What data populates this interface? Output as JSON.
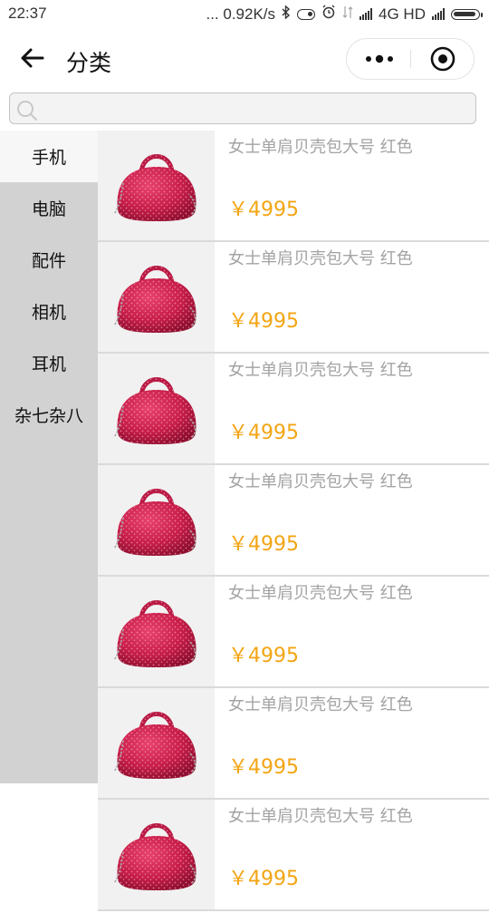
{
  "status": {
    "time": "22:37",
    "net_speed": "0.92K/s",
    "network": "4G HD",
    "battery_level": 0.9
  },
  "header": {
    "title": "分类",
    "back_icon": "arrow-left-icon",
    "more_icon": "more-dots-icon",
    "close_icon": "target-icon"
  },
  "search": {
    "placeholder": "",
    "value": ""
  },
  "categories": [
    {
      "label": "手机",
      "active": true
    },
    {
      "label": "电脑",
      "active": false
    },
    {
      "label": "配件",
      "active": false
    },
    {
      "label": "相机",
      "active": false
    },
    {
      "label": "耳机",
      "active": false
    },
    {
      "label": "杂七杂八",
      "active": false
    }
  ],
  "products": [
    {
      "name": "女士单肩贝壳包大号 红色",
      "price": "￥4995"
    },
    {
      "name": "女士单肩贝壳包大号 红色",
      "price": "￥4995"
    },
    {
      "name": "女士单肩贝壳包大号 红色",
      "price": "￥4995"
    },
    {
      "name": "女士单肩贝壳包大号 红色",
      "price": "￥4995"
    },
    {
      "name": "女士单肩贝壳包大号 红色",
      "price": "￥4995"
    },
    {
      "name": "女士单肩贝壳包大号 红色",
      "price": "￥4995"
    },
    {
      "name": "女士单肩贝壳包大号 红色",
      "price": "￥4995"
    }
  ],
  "colors": {
    "price": "#f3a514",
    "sidebar_bg": "#d2d2d2",
    "active_category_bg": "#f7f7f7"
  }
}
